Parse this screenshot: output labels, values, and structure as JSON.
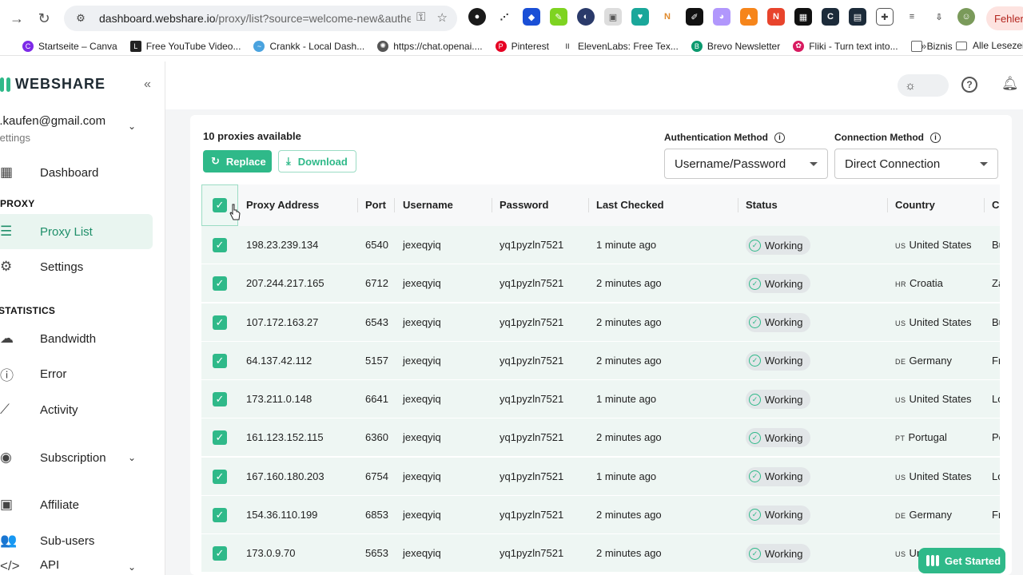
{
  "browser": {
    "url_main": "dashboard.webshare.io",
    "url_rest": "/proxy/list?source=welcome-new&authen...",
    "error_chip": "Fehler",
    "bookmarks": [
      {
        "label": "Startseite – Canva",
        "color": "#7d2ae8"
      },
      {
        "label": "Free YouTube Video...",
        "color": "#222222"
      },
      {
        "label": "Crankk - Local Dash...",
        "color": "#4aa3df"
      },
      {
        "label": "https://chat.openai....",
        "color": "#555555"
      },
      {
        "label": "Pinterest",
        "color": "#e60023"
      },
      {
        "label": "ElevenLabs: Free Tex...",
        "color": "#111111"
      },
      {
        "label": "Brevo Newsletter",
        "color": "#0b996e"
      },
      {
        "label": "Fliki - Turn text into...",
        "color": "#d81b60"
      },
      {
        "label": "Biznis",
        "color": "#666666"
      }
    ],
    "bookmarks_more": "»",
    "all_bookmarks": "Alle Lesezeic"
  },
  "sidebar": {
    "brand": "WEBSHARE",
    "account_email": "b.kaufen@gmail.com",
    "account_sub": "Settings",
    "items": [
      {
        "label": "Dashboard",
        "icon": "grid"
      },
      {
        "label": "Proxy List",
        "icon": "list"
      },
      {
        "label": "Settings",
        "icon": "gear"
      },
      {
        "label": "Bandwidth",
        "icon": "cloud"
      },
      {
        "label": "Error",
        "icon": "alert"
      },
      {
        "label": "Activity",
        "icon": "trend"
      },
      {
        "label": "Subscription",
        "icon": "user"
      },
      {
        "label": "Affiliate",
        "icon": "gift"
      },
      {
        "label": "Sub-users",
        "icon": "users"
      },
      {
        "label": "API",
        "icon": "code"
      }
    ],
    "sections": {
      "proxy": "PROXY",
      "statistics": "STATISTICS"
    }
  },
  "main": {
    "available": "10 proxies available",
    "replace_label": "Replace",
    "download_label": "Download",
    "auth_label": "Authentication Method",
    "auth_value": "Username/Password",
    "conn_label": "Connection Method",
    "conn_value": "Direct Connection",
    "get_started": "Get Started"
  },
  "table": {
    "headers": [
      "Proxy Address",
      "Port",
      "Username",
      "Password",
      "Last Checked",
      "Status",
      "Country",
      "Ci"
    ],
    "rows": [
      {
        "ip": "198.23.239.134",
        "port": "6540",
        "user": "jexeqyiq",
        "pass": "yq1pyzln7521",
        "checked": "1 minute ago",
        "status": "Working",
        "cc": "US",
        "country": "United States",
        "city": "Bu"
      },
      {
        "ip": "207.244.217.165",
        "port": "6712",
        "user": "jexeqyiq",
        "pass": "yq1pyzln7521",
        "checked": "2 minutes ago",
        "status": "Working",
        "cc": "HR",
        "country": "Croatia",
        "city": "Za"
      },
      {
        "ip": "107.172.163.27",
        "port": "6543",
        "user": "jexeqyiq",
        "pass": "yq1pyzln7521",
        "checked": "2 minutes ago",
        "status": "Working",
        "cc": "US",
        "country": "United States",
        "city": "Bu"
      },
      {
        "ip": "64.137.42.112",
        "port": "5157",
        "user": "jexeqyiq",
        "pass": "yq1pyzln7521",
        "checked": "2 minutes ago",
        "status": "Working",
        "cc": "DE",
        "country": "Germany",
        "city": "Fr"
      },
      {
        "ip": "173.211.0.148",
        "port": "6641",
        "user": "jexeqyiq",
        "pass": "yq1pyzln7521",
        "checked": "1 minute ago",
        "status": "Working",
        "cc": "US",
        "country": "United States",
        "city": "Lo"
      },
      {
        "ip": "161.123.152.115",
        "port": "6360",
        "user": "jexeqyiq",
        "pass": "yq1pyzln7521",
        "checked": "2 minutes ago",
        "status": "Working",
        "cc": "PT",
        "country": "Portugal",
        "city": "Po"
      },
      {
        "ip": "167.160.180.203",
        "port": "6754",
        "user": "jexeqyiq",
        "pass": "yq1pyzln7521",
        "checked": "1 minute ago",
        "status": "Working",
        "cc": "US",
        "country": "United States",
        "city": "Lo"
      },
      {
        "ip": "154.36.110.199",
        "port": "6853",
        "user": "jexeqyiq",
        "pass": "yq1pyzln7521",
        "checked": "2 minutes ago",
        "status": "Working",
        "cc": "DE",
        "country": "Germany",
        "city": "Fr"
      },
      {
        "ip": "173.0.9.70",
        "port": "5653",
        "user": "jexeqyiq",
        "pass": "yq1pyzln7521",
        "checked": "2 minutes ago",
        "status": "Working",
        "cc": "US",
        "country": "United States",
        "city": ""
      }
    ]
  },
  "colors": {
    "accent": "#2fb989",
    "row_bg": "#eef6f3"
  }
}
